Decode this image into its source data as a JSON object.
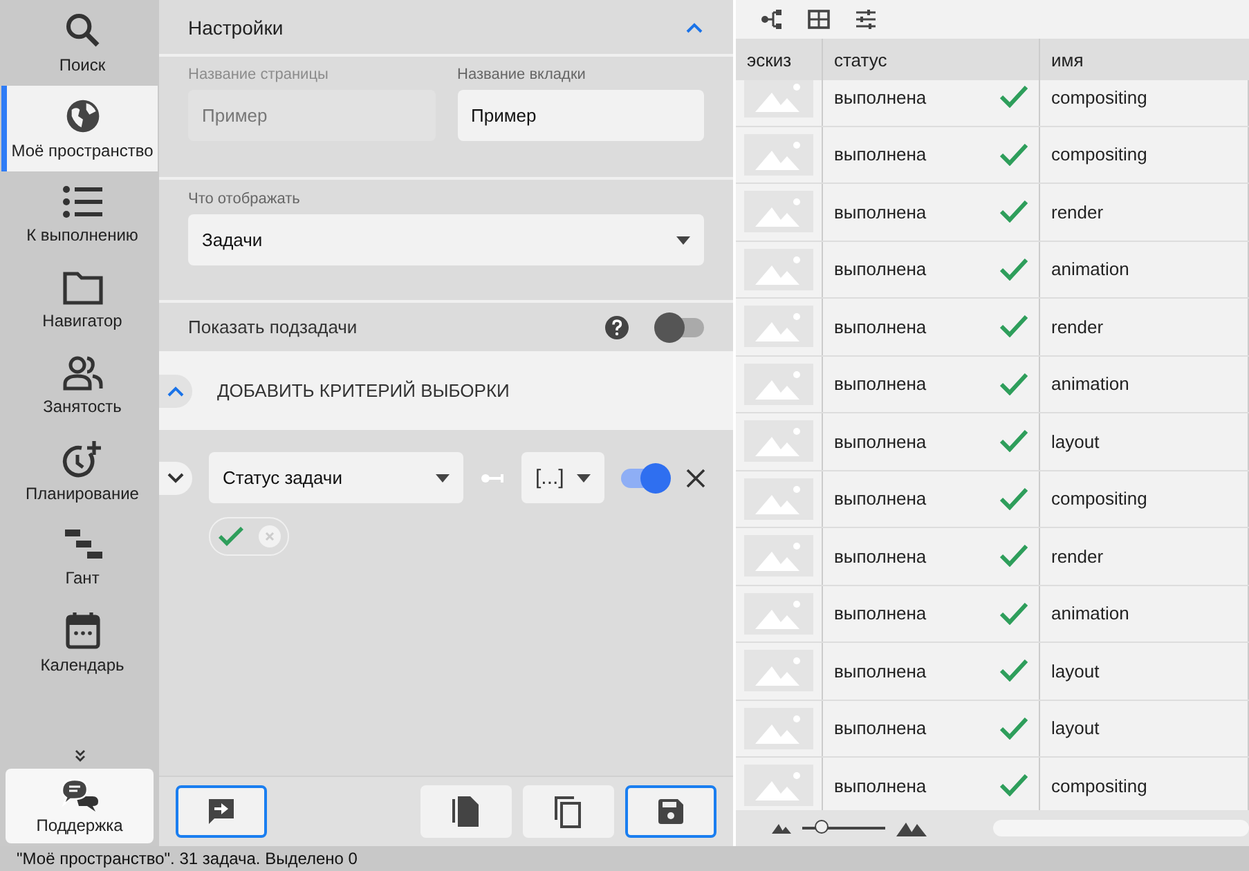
{
  "sidebar": {
    "items": [
      {
        "kind": "search",
        "label": "Поиск",
        "selected": false
      },
      {
        "kind": "globe",
        "label": "Моё пространство",
        "selected": true
      },
      {
        "kind": "list",
        "label": "К выполнению",
        "selected": false
      },
      {
        "kind": "folder",
        "label": "Навигатор",
        "selected": false
      },
      {
        "kind": "people",
        "label": "Занятость",
        "selected": false
      },
      {
        "kind": "clock",
        "label": "Планирование",
        "selected": false
      },
      {
        "kind": "gantt",
        "label": "Гант",
        "selected": false
      },
      {
        "kind": "calendar",
        "label": "Календарь",
        "selected": false
      }
    ],
    "support": "Поддержка"
  },
  "settings": {
    "title": "Настройки",
    "expanded": true,
    "page_name": {
      "label": "Название страницы",
      "value": "Пример",
      "disabled": true
    },
    "tab_name": {
      "label": "Название вкладки",
      "value": "Пример",
      "disabled": false
    },
    "display": {
      "label": "Что отображать",
      "value": "Задачи"
    },
    "subtasks": {
      "label": "Показать подзадачи",
      "on": false
    },
    "add_criterion": {
      "label": "ДОБАВИТЬ КРИТЕРИЙ ВЫБОРКИ",
      "expanded": true
    },
    "criterion": {
      "field": "Статус задачи",
      "operator": "[...]",
      "on": true,
      "expanded": true
    }
  },
  "table": {
    "columns": [
      "эскиз",
      "статус",
      "имя"
    ],
    "rows": [
      {
        "status": "выполнена",
        "name": "compositing"
      },
      {
        "status": "выполнена",
        "name": "compositing"
      },
      {
        "status": "выполнена",
        "name": "render"
      },
      {
        "status": "выполнена",
        "name": "animation"
      },
      {
        "status": "выполнена",
        "name": "render"
      },
      {
        "status": "выполнена",
        "name": "animation"
      },
      {
        "status": "выполнена",
        "name": "layout"
      },
      {
        "status": "выполнена",
        "name": "compositing"
      },
      {
        "status": "выполнена",
        "name": "render"
      },
      {
        "status": "выполнена",
        "name": "animation"
      },
      {
        "status": "выполнена",
        "name": "layout"
      },
      {
        "status": "выполнена",
        "name": "layout"
      },
      {
        "status": "выполнена",
        "name": "compositing"
      }
    ],
    "zoom": {
      "level": 0.23
    }
  },
  "status_bar": "\"Моё пространство\". 31 задача. Выделено 0"
}
